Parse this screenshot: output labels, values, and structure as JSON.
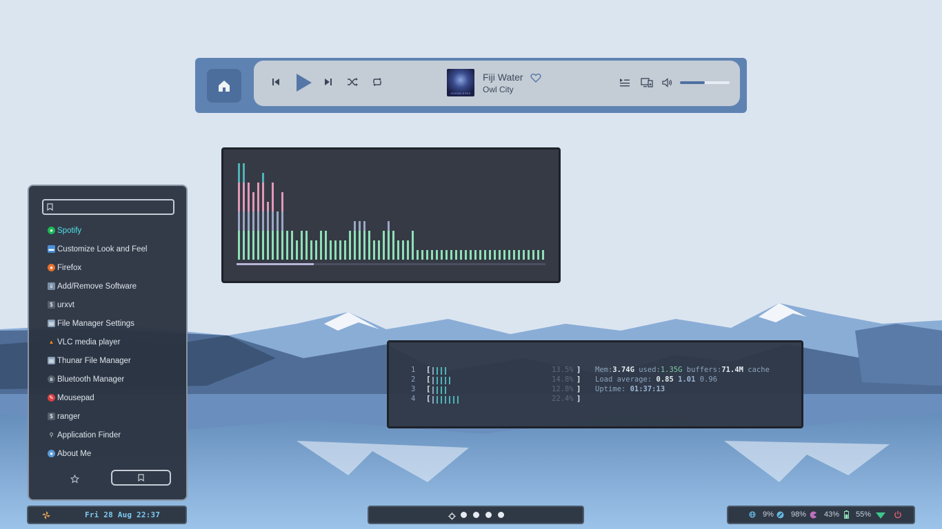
{
  "player": {
    "track_title": "Fiji Water",
    "track_artist": "Owl City",
    "album_caption": "OCEAN EYES",
    "volume_fraction": 0.5,
    "icons": [
      "home-icon",
      "previous-icon",
      "play-icon",
      "next-icon",
      "shuffle-icon",
      "repeat-icon",
      "heart-icon",
      "queue-icon",
      "devices-icon",
      "volume-icon"
    ]
  },
  "visualizer": {
    "bars": [
      140,
      140,
      112,
      98,
      112,
      126,
      84,
      112,
      70,
      98,
      42,
      42,
      28,
      42,
      42,
      28,
      28,
      42,
      42,
      28,
      28,
      28,
      28,
      42,
      56,
      56,
      56,
      42,
      28,
      28,
      42,
      56,
      42,
      28,
      28,
      28,
      42,
      14,
      14,
      14,
      14,
      14,
      14,
      14,
      14,
      14,
      14,
      14,
      14,
      14,
      14,
      14,
      14,
      14,
      14,
      14,
      14,
      14,
      14,
      14,
      14,
      14,
      14,
      14
    ],
    "progress_fraction": 0.25,
    "colors": {
      "low": "#8ee0b6",
      "mid": "#9aa7c4",
      "high": "#e09ab8",
      "top": "#4fb3b7"
    }
  },
  "launcher": {
    "search_placeholder": "",
    "apps": [
      {
        "label": "Spotify",
        "icon": "spotify-icon",
        "active": true
      },
      {
        "label": "Customize Look and Feel",
        "icon": "customize-icon"
      },
      {
        "label": "Firefox",
        "icon": "firefox-icon"
      },
      {
        "label": "Add/Remove Software",
        "icon": "software-icon"
      },
      {
        "label": "urxvt",
        "icon": "terminal-icon"
      },
      {
        "label": "File Manager Settings",
        "icon": "file-manager-settings-icon"
      },
      {
        "label": "VLC media player",
        "icon": "vlc-icon"
      },
      {
        "label": "Thunar File Manager",
        "icon": "thunar-icon"
      },
      {
        "label": "Bluetooth Manager",
        "icon": "bluetooth-icon"
      },
      {
        "label": "Mousepad",
        "icon": "mousepad-icon"
      },
      {
        "label": "ranger",
        "icon": "terminal-icon"
      },
      {
        "label": "Application Finder",
        "icon": "search-icon"
      },
      {
        "label": "About Me",
        "icon": "user-icon"
      }
    ]
  },
  "htop": {
    "cpus": [
      {
        "num": "1",
        "pct": "13.5%",
        "bars": 4
      },
      {
        "num": "2",
        "pct": "14.8%",
        "bars": 5
      },
      {
        "num": "3",
        "pct": "12.8%",
        "bars": 4
      },
      {
        "num": "4",
        "pct": "22.4%",
        "bars": 7
      }
    ],
    "lb": "[",
    "rb": "]",
    "mem_label": "Mem:",
    "mem_total": "3.74G",
    "mem_used_label": " used:",
    "mem_used": "1.35G",
    "mem_buffers_label": " buffers:",
    "mem_buffers": "71.4M",
    "mem_cache_label": " cache",
    "load_label": "Load average: ",
    "load_1": "0.85",
    "load_5": "1.01",
    "load_15": "0.96",
    "uptime_label": "Uptime: ",
    "uptime": "01:37:13"
  },
  "taskbar": {
    "clock": "Fri 28 Aug 22:37",
    "workspaces": 5,
    "active_workspace": 1,
    "stats": [
      {
        "icon": "cpu-icon",
        "value": "9%",
        "color": "#66b7e0"
      },
      {
        "icon": "disk-icon",
        "value": "98%",
        "color": "#66b7e0"
      },
      {
        "icon": "memory-icon",
        "value": "43%",
        "color": "#c070c0"
      },
      {
        "icon": "battery-icon",
        "value": "55%",
        "color": "#8ee0b6"
      }
    ],
    "wifi_color": "#3cc78a",
    "power_color": "#e06070"
  }
}
